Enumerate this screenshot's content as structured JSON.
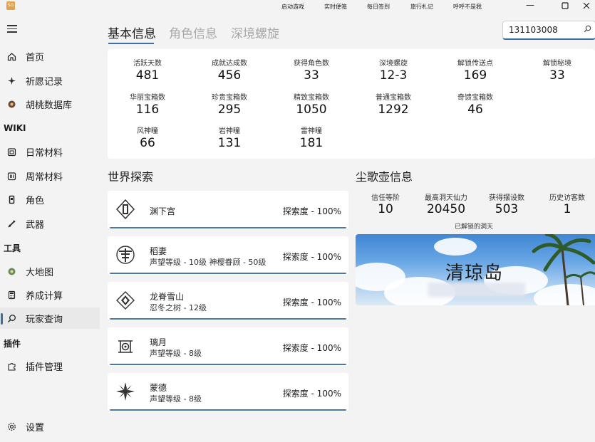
{
  "app": {
    "icon_label": "SG"
  },
  "sidebar": {
    "items": [
      {
        "label": "首页",
        "icon": "home-icon"
      },
      {
        "label": "祈愿记录",
        "icon": "sparkle-icon"
      },
      {
        "label": "胡桃数据库",
        "icon": "database-icon"
      }
    ],
    "wiki_label": "WIKI",
    "wiki_items": [
      {
        "label": "日常材料",
        "icon": "calendar-icon"
      },
      {
        "label": "周常材料",
        "icon": "calendar-week-icon"
      },
      {
        "label": "角色",
        "icon": "character-icon"
      },
      {
        "label": "武器",
        "icon": "weapon-icon"
      }
    ],
    "tools_label": "工具",
    "tools_items": [
      {
        "label": "大地图",
        "icon": "map-icon"
      },
      {
        "label": "养成计算",
        "icon": "calculator-icon"
      },
      {
        "label": "玩家查询",
        "icon": "search-icon"
      }
    ],
    "plugins_label": "插件",
    "plugins_items": [
      {
        "label": "插件管理",
        "icon": "puzzle-icon"
      }
    ],
    "settings_label": "设置"
  },
  "topbar": {
    "links": [
      "启动游戏",
      "实时便笺",
      "每日签到",
      "旅行札记",
      "呼呼不是我"
    ]
  },
  "tabs": [
    "基本信息",
    "角色信息",
    "深境螺旋"
  ],
  "search": {
    "value": "131103008"
  },
  "stats": [
    {
      "label": "活跃天数",
      "value": "481"
    },
    {
      "label": "成就达成数",
      "value": "456"
    },
    {
      "label": "获得角色数",
      "value": "33"
    },
    {
      "label": "深境螺旋",
      "value": "12-3"
    },
    {
      "label": "解锁传送点",
      "value": "169"
    },
    {
      "label": "解锁秘境",
      "value": "33"
    },
    {
      "label": "华丽宝箱数",
      "value": "116"
    },
    {
      "label": "珍贵宝箱数",
      "value": "295"
    },
    {
      "label": "精致宝箱数",
      "value": "1050"
    },
    {
      "label": "普通宝箱数",
      "value": "1292"
    },
    {
      "label": "奇馈宝箱数",
      "value": "46"
    },
    {
      "label": "风神瞳",
      "value": "66"
    },
    {
      "label": "岩神瞳",
      "value": "131"
    },
    {
      "label": "雷神瞳",
      "value": "181"
    }
  ],
  "world": {
    "title": "世界探索",
    "regions": [
      {
        "name": "渊下宫",
        "sub": "",
        "explore": "探索度 - 100%"
      },
      {
        "name": "稻妻",
        "sub": "声望等级 - 10级  神樱眷顾 - 50级",
        "explore": "探索度 - 100%"
      },
      {
        "name": "龙脊雪山",
        "sub": "忍冬之树 - 12级",
        "explore": "探索度 - 100%"
      },
      {
        "name": "璃月",
        "sub": "声望等级 - 8级",
        "explore": "探索度 - 100%"
      },
      {
        "name": "蒙德",
        "sub": "声望等级 - 8级",
        "explore": "探索度 - 100%"
      }
    ]
  },
  "teapot": {
    "title": "尘歌壶信息",
    "stats": [
      {
        "label": "信任等阶",
        "value": "10"
      },
      {
        "label": "最高洞天仙力",
        "value": "20450"
      },
      {
        "label": "获得摆设数",
        "value": "503"
      },
      {
        "label": "历史访客数",
        "value": "1"
      }
    ],
    "unlocked_label": "已解锁的洞天",
    "realm_name": "清琼岛"
  },
  "colors": {
    "accent": "#3a6ea5",
    "background": "#f3f3f3",
    "card": "#ffffff"
  }
}
